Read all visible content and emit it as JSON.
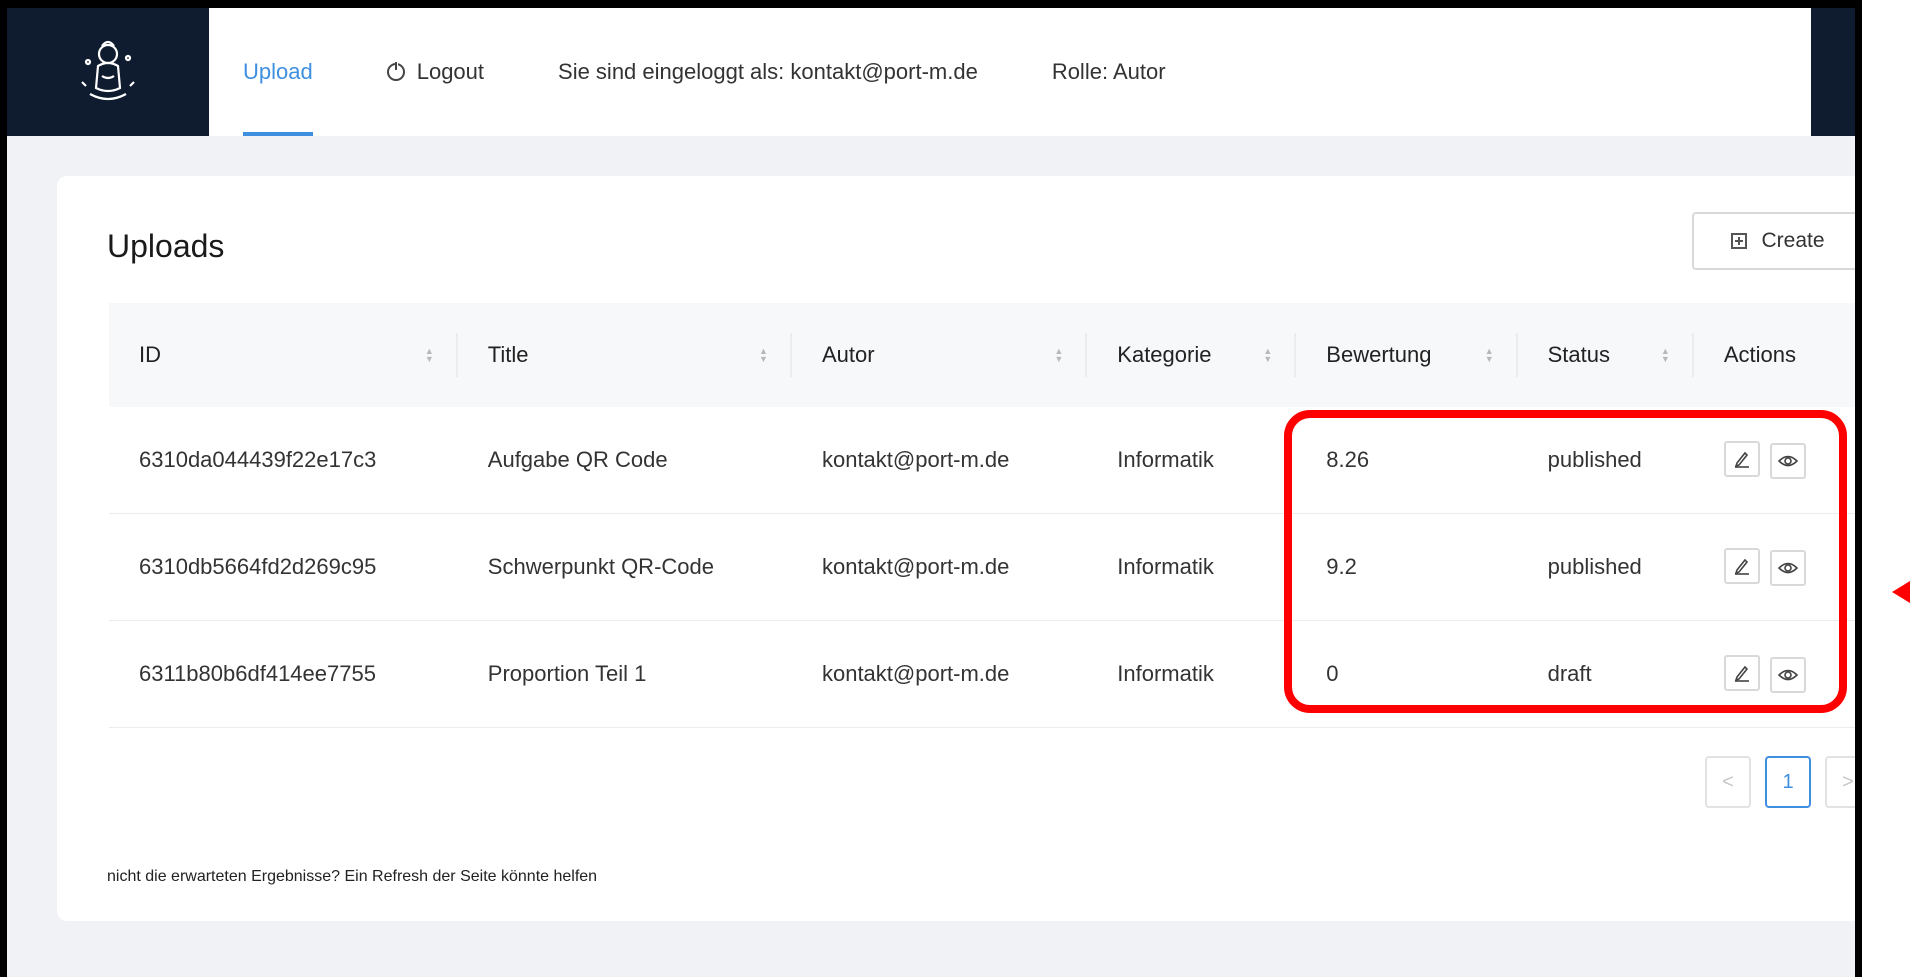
{
  "header": {
    "nav": [
      {
        "label": "Upload",
        "active": true
      },
      {
        "label": "Logout",
        "icon": "logout-icon"
      }
    ],
    "logged_in_text": "Sie sind eingeloggt als: kontakt@port-m.de",
    "role_text": "Rolle: Autor"
  },
  "card": {
    "title": "Uploads",
    "create_label": "Create"
  },
  "table": {
    "columns": [
      "ID",
      "Title",
      "Autor",
      "Kategorie",
      "Bewertung",
      "Status",
      "Actions"
    ],
    "rows": [
      {
        "id": "6310da044439f22e17c3",
        "title": "Aufgabe QR Code",
        "autor": "kontakt@port-m.de",
        "kategorie": "Informatik",
        "bewertung": "8.26",
        "status": "published"
      },
      {
        "id": "6310db5664fd2d269c95",
        "title": "Schwerpunkt QR-Code",
        "autor": "kontakt@port-m.de",
        "kategorie": "Informatik",
        "bewertung": "9.2",
        "status": "published"
      },
      {
        "id": "6311b80b6df414ee7755",
        "title": "Proportion Teil 1",
        "autor": "kontakt@port-m.de",
        "kategorie": "Informatik",
        "bewertung": "0",
        "status": "draft"
      }
    ]
  },
  "pagination": {
    "prev": "<",
    "current": "1",
    "next": ">"
  },
  "footnote": "nicht die erwarteten Ergebnisse? Ein Refresh der Seite könnte helfen",
  "colors": {
    "accent": "#3f8fe0",
    "header_dark": "#0f1b2e",
    "highlight": "#ff0000"
  }
}
